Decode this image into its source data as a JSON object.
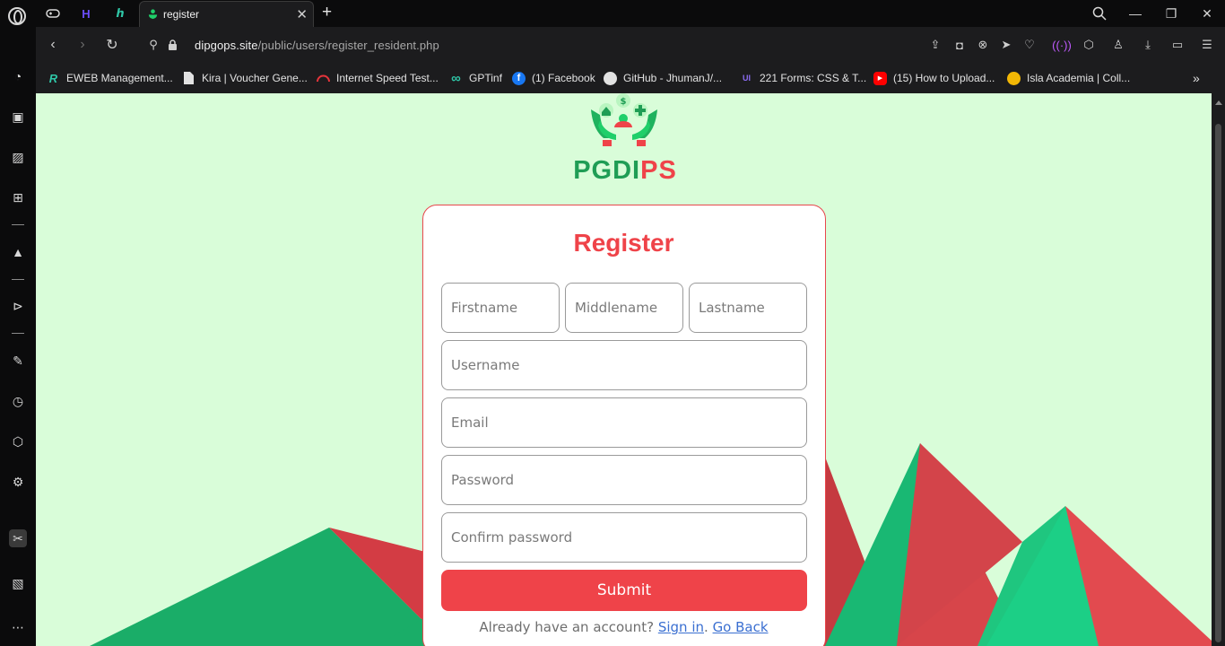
{
  "browser": {
    "active_tab_title": "register",
    "url_host": "dipgops.site",
    "url_path": "/public/users/register_resident.php"
  },
  "bookmarks": [
    {
      "label": "EWEB Management...",
      "icon": "r-logo-icon",
      "color": "#2fc6a7",
      "glyph": "R"
    },
    {
      "label": "Kira | Voucher Gene...",
      "icon": "document-icon",
      "color": "#e2e2e2",
      "glyph": ""
    },
    {
      "label": "Internet Speed Test...",
      "icon": "speedometer-icon",
      "color": "#e5343b",
      "glyph": ""
    },
    {
      "label": "GPTinf",
      "icon": "infinity-icon",
      "color": "#2fc6a7",
      "glyph": "∞"
    },
    {
      "label": "(1) Facebook",
      "icon": "facebook-icon",
      "color": "#1877f2",
      "glyph": "f"
    },
    {
      "label": "GitHub - JhumanJ/...",
      "icon": "github-icon",
      "color": "#e2e2e2",
      "glyph": "●"
    },
    {
      "label": "221 Forms: CSS & T...",
      "icon": "ui-logo-icon",
      "color": "#8c6cf3",
      "glyph": "UI"
    },
    {
      "label": "(15) How to Upload...",
      "icon": "youtube-icon",
      "color": "#ff0000",
      "glyph": "▶"
    },
    {
      "label": "Isla Academia | Coll...",
      "icon": "academia-icon",
      "color": "#f2b705",
      "glyph": "●"
    }
  ],
  "page": {
    "brand_green": "PGDI",
    "brand_red": "PS",
    "form_title": "Register",
    "fields": {
      "firstname_placeholder": "Firstname",
      "middlename_placeholder": "Middlename",
      "lastname_placeholder": "Lastname",
      "username_placeholder": "Username",
      "email_placeholder": "Email",
      "password_placeholder": "Password",
      "confirm_password_placeholder": "Confirm password"
    },
    "submit_label": "Submit",
    "footer_text": "Already have an account?",
    "sign_in_link": "Sign in",
    "separator": ".",
    "go_back_link": "Go Back"
  },
  "colors": {
    "page_background": "#d9fdd9",
    "brand_green": "#1f9d55",
    "brand_red": "#ef4349",
    "link": "#3a6fd1"
  }
}
